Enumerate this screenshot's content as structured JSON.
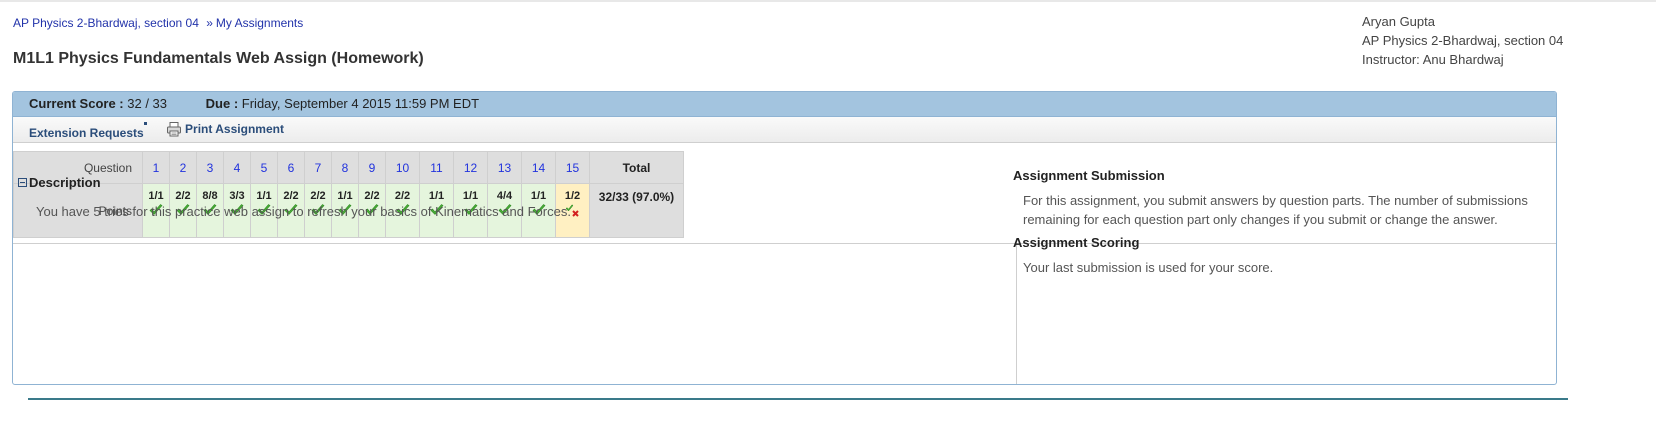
{
  "breadcrumb": {
    "course": "AP Physics 2-Bhardwaj, section 04",
    "separator": "»",
    "assignments": "My Assignments"
  },
  "page_title": "M1L1 Physics Fundamentals Web Assign (Homework)",
  "user": {
    "name": "Aryan Gupta",
    "course": "AP Physics 2-Bhardwaj, section 04",
    "instructor": "Instructor: Anu Bhardwaj"
  },
  "score_bar": {
    "score_label": "Current Score :",
    "score_value": "32 / 33",
    "due_label": "Due :",
    "due_value": "Friday, September 4 2015 11:59 PM EDT"
  },
  "toolbar": {
    "extension_label": "Extension Requests",
    "print_label": "Print Assignment"
  },
  "grid": {
    "question_label": "Question",
    "points_label": "Points",
    "total_label": "Total",
    "total_value": "32/33 (97.0%)",
    "questions": [
      {
        "num": "1",
        "points": "1/1",
        "status": "correct"
      },
      {
        "num": "2",
        "points": "2/2",
        "status": "correct"
      },
      {
        "num": "3",
        "points": "8/8",
        "status": "correct"
      },
      {
        "num": "4",
        "points": "3/3",
        "status": "correct"
      },
      {
        "num": "5",
        "points": "1/1",
        "status": "correct"
      },
      {
        "num": "6",
        "points": "2/2",
        "status": "correct"
      },
      {
        "num": "7",
        "points": "2/2",
        "status": "correct"
      },
      {
        "num": "8",
        "points": "1/1",
        "status": "correct"
      },
      {
        "num": "9",
        "points": "2/2",
        "status": "correct"
      },
      {
        "num": "10",
        "points": "2/2",
        "status": "correct"
      },
      {
        "num": "11",
        "points": "1/1",
        "status": "correct"
      },
      {
        "num": "12",
        "points": "1/1",
        "status": "correct"
      },
      {
        "num": "13",
        "points": "4/4",
        "status": "correct"
      },
      {
        "num": "14",
        "points": "1/1",
        "status": "correct"
      },
      {
        "num": "15",
        "points": "1/2",
        "status": "partial"
      }
    ]
  },
  "description": {
    "heading": "Description",
    "text": "You have 5 tries for this practice web assign to refresh your basics of Kinematics and Forces."
  },
  "submission": {
    "heading": "Assignment Submission",
    "text": "For this assignment, you submit answers by question parts. The number of submissions remaining for each question part only changes if you submit or change the answer."
  },
  "scoring": {
    "heading": "Assignment Scoring",
    "text": "Your last submission is used for your score."
  },
  "colors": {
    "score_bar": "#a3c4df",
    "correct_cell": "#e5f5dd",
    "partial_cell": "#fff0c2",
    "link": "#2233dd"
  }
}
